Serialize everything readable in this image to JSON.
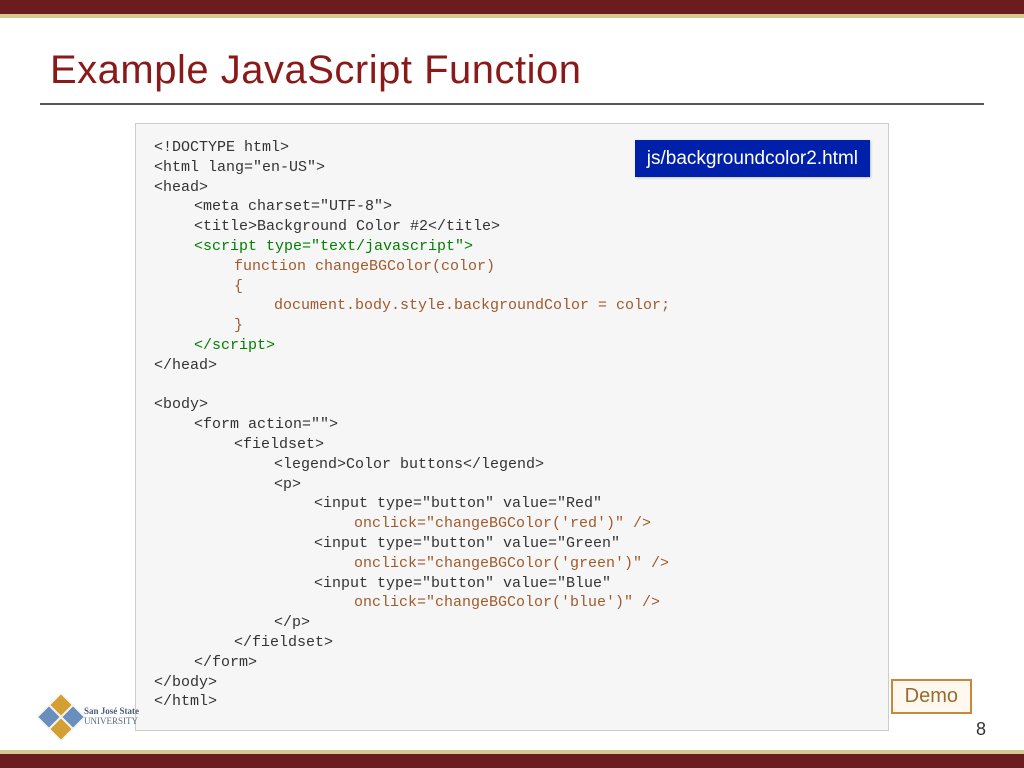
{
  "slide": {
    "title": "Example JavaScript Function",
    "page_number": "8",
    "demo_label": "Demo",
    "file_badge": "js/backgroundcolor2.html"
  },
  "logo": {
    "line1": "San José State",
    "line2": "UNIVERSITY"
  },
  "code": {
    "l01": "<!DOCTYPE html>",
    "l02": "<html lang=\"en-US\">",
    "l03": "<head>",
    "l04": "<meta charset=\"UTF-8\">",
    "l05": "<title>Background Color #2</title>",
    "l06": "<script type=\"text/javascript\">",
    "l07": "function changeBGColor(color)",
    "l08": "{",
    "l09": "document.body.style.backgroundColor = color;",
    "l10": "}",
    "l11": "</script>",
    "l12": "</head>",
    "l13": "<body>",
    "l14": "<form action=\"\">",
    "l15": "<fieldset>",
    "l16": "<legend>Color buttons</legend>",
    "l17": "<p>",
    "l18": "<input type=\"button\" value=\"Red\"",
    "l19": "onclick=\"changeBGColor('red')\" />",
    "l20": "<input type=\"button\" value=\"Green\"",
    "l21": "onclick=\"changeBGColor('green')\" />",
    "l22": "<input type=\"button\" value=\"Blue\"",
    "l23": "onclick=\"changeBGColor('blue')\" />",
    "l24": "</p>",
    "l25": "</fieldset>",
    "l26": "</form>",
    "l27": "</body>",
    "l28": "</html>"
  }
}
